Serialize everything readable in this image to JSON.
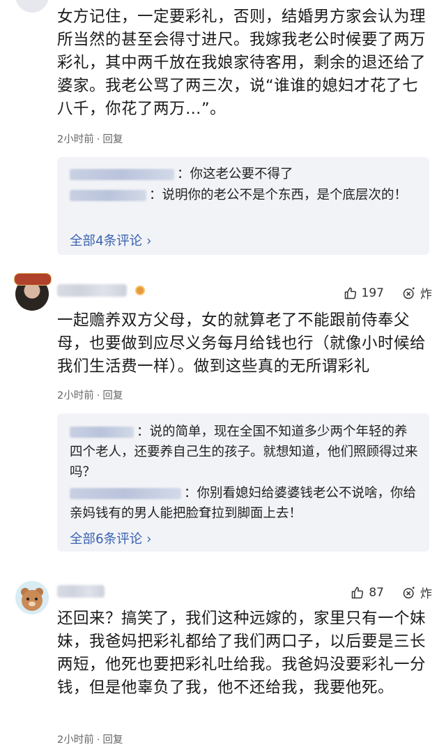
{
  "comments": [
    {
      "text": "女方记住，一定要彩礼，否则，结婚男方家会认为理所当然的甚至会得寸进尺。我嫁我老公时候要了两万彩礼，其中两千放在我娘家待客用，剩余的退还给了婆家。我老公骂了两三次，说“谁谁的媳妇才花了七八千，你花了两万…”。",
      "time": "2小时前",
      "reply_label": "回复",
      "replies": [
        {
          "text": "你这老公要不得了"
        },
        {
          "text": "说明你的老公不是个东西，是个底层次的！"
        }
      ],
      "more": "全部4条评论"
    },
    {
      "likes": "197",
      "fire_label": "炸",
      "text": "一起赡养双方父母，女的就算老了不能跟前侍奉父母，也要做到应尽义务每月给钱也行（就像小时候给我们生活费一样）。做到这些真的无所谓彩礼",
      "time": "2小时前",
      "reply_label": "回复",
      "replies": [
        {
          "text": "说的简单，现在全国不知道多少两个年轻的养四个老人，还要养自己生的孩子。就想知道，他们照顾得过来吗？"
        },
        {
          "text": "你别看媳妇给婆婆钱老公不说啥，你给亲妈钱有的男人能把脸耷拉到脚面上去！"
        }
      ],
      "more": "全部6条评论"
    },
    {
      "likes": "87",
      "fire_label": "炸",
      "text": "还回来？搞笑了，我们这种远嫁的，家里只有一个妹妹，我爸妈把彩礼都给了我们两口子，以后要是三长两短，他死也要把彩礼吐给我。我爸妈没要彩礼一分钱，但是他辜负了我，他不还给我，我要他死。",
      "time": "2小时前",
      "reply_label": "回复"
    }
  ]
}
